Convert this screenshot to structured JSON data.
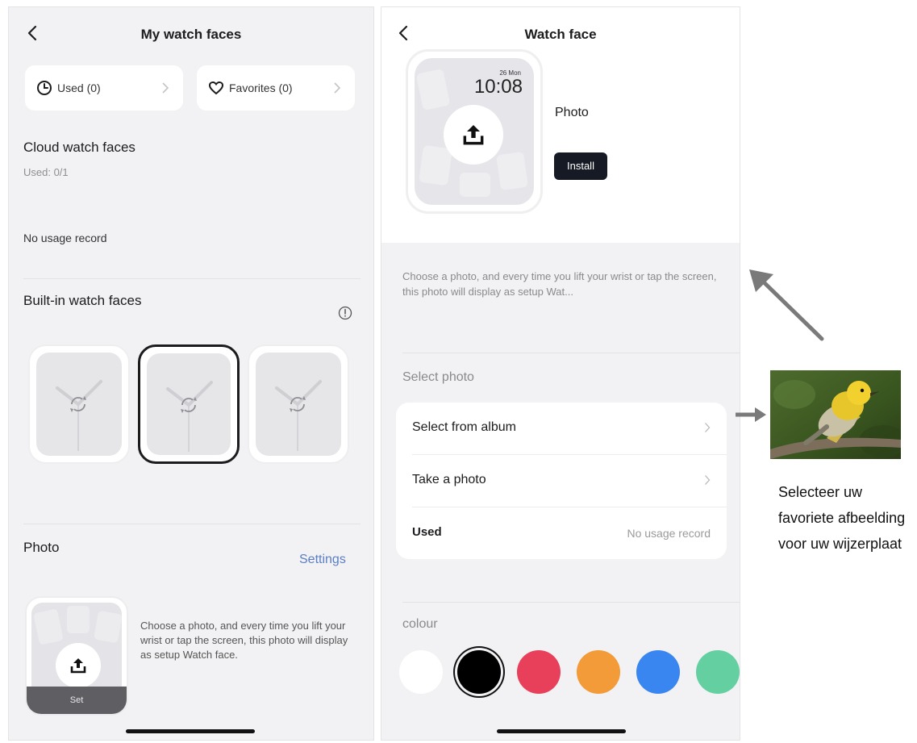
{
  "left": {
    "title": "My watch faces",
    "used_btn": "Used (0)",
    "favorites_btn": "Favorites (0)",
    "cloud_title": "Cloud watch faces",
    "cloud_used": "Used: 0/1",
    "no_usage": "No usage record",
    "builtin_title": "Built-in watch faces",
    "photo_title": "Photo",
    "settings_link": "Settings",
    "set_label": "Set",
    "photo_desc": "Choose a photo, and every time you lift your wrist or tap the screen, this photo will display as setup Watch face."
  },
  "right": {
    "title": "Watch face",
    "preview_date": "26 Mon",
    "preview_time": "10:08",
    "face_name": "Photo",
    "install_label": "Install",
    "description": "Choose a photo, and every time you lift your wrist or tap the screen, this photo will display as setup Wat...",
    "select_photo_label": "Select photo",
    "rows": [
      {
        "label": "Select from album"
      },
      {
        "label": "Take a photo"
      },
      {
        "label": "Used",
        "value": "No usage record"
      }
    ],
    "colour_label": "colour",
    "colours": [
      "#ffffff",
      "#000000",
      "#e8405a",
      "#f29b38",
      "#3a86f0",
      "#64cfa0"
    ],
    "selected_colour_index": 1
  },
  "annotation": {
    "caption": "Selecteer uw favoriete afbeelding voor uw wijzerplaat"
  }
}
